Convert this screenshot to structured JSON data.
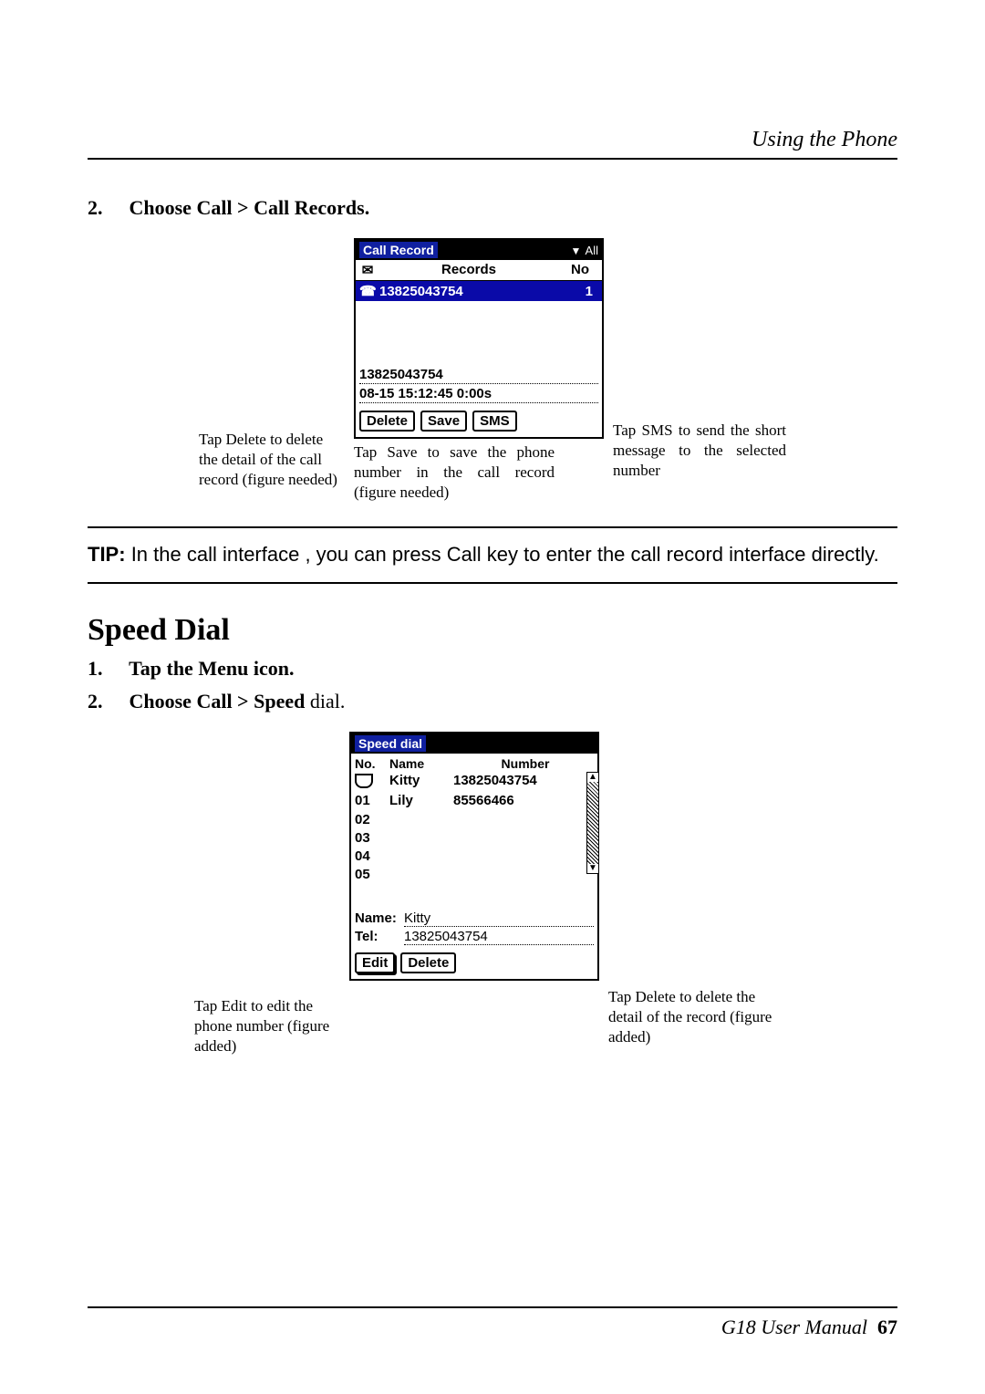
{
  "header": {
    "section_title": "Using the Phone"
  },
  "steps_a": {
    "step2_num": "2.",
    "step2_text": "Choose Call > Call Records."
  },
  "fig1": {
    "annot_left": "Tap Delete to delete the detail of the call record (figure needed)",
    "annot_under": "Tap Save to save the phone number in the call record (figure needed)",
    "annot_right": "Tap SMS to send the short message to the selected number",
    "titlebar": "Call Record",
    "filter_all": "All",
    "col_records": "Records",
    "col_no": "No",
    "row_number": "13825043754",
    "row_no": "1",
    "detail_number": "13825043754",
    "detail_time": "08-15  15:12:45  0:00s",
    "btn_delete": "Delete",
    "btn_save": "Save",
    "btn_sms": "SMS"
  },
  "tip": {
    "label": "TIP:",
    "text": "In the call interface , you can press Call key to enter the call record interface directly."
  },
  "section_title": "Speed Dial",
  "steps_b": {
    "step1_num": "1.",
    "step1_text": "Tap the Menu icon.",
    "step2_num": "2.",
    "step2_text_a": "Choose Call > Speed ",
    "step2_text_b": "dial."
  },
  "fig2": {
    "annot_left": "Tap Edit to edit the phone number (figure added)",
    "annot_right": "Tap Delete to delete the detail of the record (figure added)",
    "titlebar": "Speed dial",
    "col_no": "No.",
    "col_name": "Name",
    "col_number": "Number",
    "rows": [
      {
        "no": "",
        "name": "Kitty",
        "number": "13825043754"
      },
      {
        "no": "01",
        "name": "Lily",
        "number": "85566466"
      },
      {
        "no": "02",
        "name": "",
        "number": ""
      },
      {
        "no": "03",
        "name": "",
        "number": ""
      },
      {
        "no": "04",
        "name": "",
        "number": ""
      },
      {
        "no": "05",
        "name": "",
        "number": ""
      }
    ],
    "name_label": "Name:",
    "name_value": "Kitty",
    "tel_label": "Tel:",
    "tel_value": "13825043754",
    "btn_edit": "Edit",
    "btn_delete": "Delete"
  },
  "footer": {
    "manual": "G18 User Manual",
    "page": "67"
  }
}
